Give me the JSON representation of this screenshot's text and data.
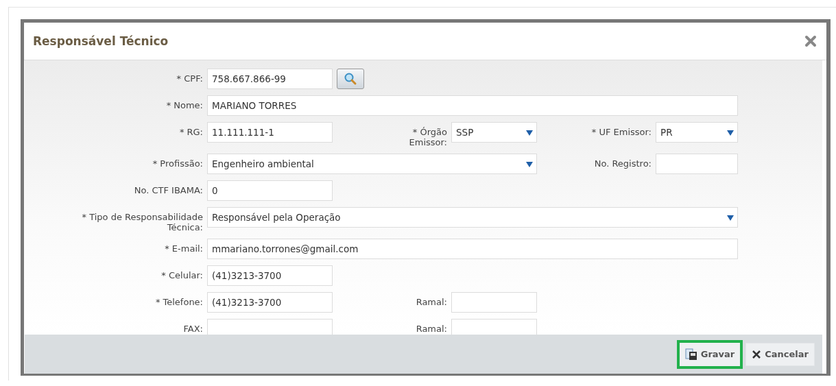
{
  "dialog": {
    "title": "Responsável Técnico"
  },
  "rows": [
    {
      "fields": [
        {
          "label": "* CPF:",
          "value": "758.667.866-99",
          "kind": "search"
        }
      ]
    },
    {
      "fields": [
        {
          "label": "* Nome:",
          "value": "MARIANO TORRES",
          "kind": "wide-text"
        }
      ]
    },
    {
      "fields": [
        {
          "label": "* RG:",
          "value": "11.111.111-1",
          "kind": "text"
        },
        {
          "label": "* Órgão Emissor:",
          "value": "SSP",
          "kind": "select"
        },
        {
          "label": "* UF Emissor:",
          "value": "PR",
          "kind": "select"
        }
      ]
    },
    {
      "fields": [
        {
          "label": "* Profissão:",
          "value": "Engenheiro ambiental",
          "kind": "wide-select"
        },
        {
          "label": "No. Registro:",
          "kind": "text"
        }
      ]
    },
    {
      "fields": [
        {
          "label": "No. CTF IBAMA:",
          "value": "0",
          "kind": "text"
        }
      ]
    },
    {
      "fields": [
        {
          "label": "* Tipo de Responsabilidade Técnica:",
          "value": "Responsável pela Operação",
          "kind": "wide-select"
        }
      ]
    },
    {
      "fields": [
        {
          "label": "* E-mail:",
          "value": "mmariano.torrones@gmail.com",
          "kind": "wide-text"
        }
      ]
    },
    {
      "fields": [
        {
          "label": "* Celular:",
          "value": "(41)3213-3700",
          "kind": "text"
        }
      ]
    },
    {
      "fields": [
        {
          "label": "* Telefone:",
          "value": "(41)3213-3700",
          "kind": "text"
        },
        {
          "label": "Ramal:",
          "kind": "text"
        }
      ]
    },
    {
      "fields": [
        {
          "label": "FAX:",
          "kind": "text"
        },
        {
          "label": "Ramal:",
          "kind": "text"
        }
      ]
    }
  ],
  "buttons": [
    {
      "label": "Gravar",
      "kind": "save",
      "highlighted": true
    },
    {
      "label": "Cancelar",
      "kind": "cancel",
      "highlighted": false
    }
  ]
}
